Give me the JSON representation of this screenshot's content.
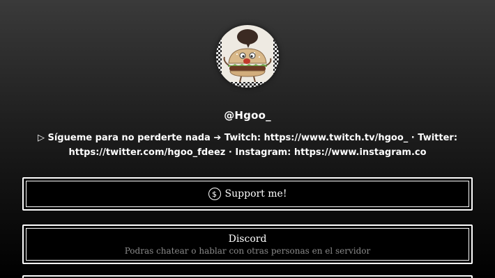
{
  "profile": {
    "username": "@Hgoo_",
    "avatar_icon": "burger-mascot-avatar",
    "bio_line1": "▷ Sígueme para no perderte nada ➔ Twitch: https://www.twitch.tv/hgoo_ · Twitter:",
    "bio_line2": "https://twitter.com/hgoo_fdeez · Instagram: https://www.instagram.co"
  },
  "links": [
    {
      "title": "Support me!",
      "icon": "dollar-icon",
      "description": ""
    },
    {
      "title": "Discord",
      "icon": "",
      "description": "Podras chatear o hablar con otras personas en el servidor"
    }
  ],
  "colors": {
    "background_top": "#3a3a3a",
    "background_bottom": "#000000",
    "button_background": "#000000",
    "button_border": "#ffffff",
    "description_text": "#8a8a8a"
  }
}
